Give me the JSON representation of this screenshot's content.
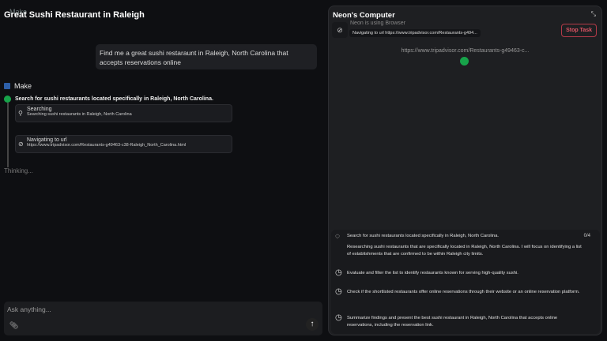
{
  "chat": {
    "title": "Great Sushi Restaurant in Raleigh",
    "ghost": "Make",
    "user_message": "Find me a great sushi restaraunt in Raleigh, North Carolina that accepts reservations online",
    "agent": "Make",
    "step": "Search for sushi restaurants located specifically in Raleigh, North Carolina.",
    "cards": [
      {
        "title": "Searching",
        "sub": "Searching sushi restaurants in Raleigh, North Carolina",
        "icon": "search-icon"
      },
      {
        "title": "Navigating to url",
        "sub": "https://www.tripadvisor.com/Restaurants-g49463-c38-Raleigh_North_Carolina.html",
        "icon": "compass-icon"
      }
    ],
    "thinking": "Thinking...",
    "input_placeholder": "Ask anything..."
  },
  "computer": {
    "title": "Neon's Computer",
    "using": "Neon is using Browser",
    "nav": "Navigating to url https://www.tripadvisor.com/Restaurants-g494...",
    "stop": "Stop Task",
    "url": "https://www.tripadvisor.com/Restaurants-g49463-c...",
    "count": "0/4",
    "tasks": [
      {
        "text": "Search for sushi restaurants located specifically in Raleigh, North Carolina.",
        "detail": "Researching sushi restaurants that are specifically located in Raleigh, North Carolina. I will focus on identifying a list of establishments that are confirmed to be within Raleigh city limits.",
        "status": "in-progress"
      },
      {
        "text": "Evaluate and filter the list to identify restaurants known for serving high-quality sushi.",
        "status": "pending"
      },
      {
        "text": "Check if the shortlisted restaurants offer online reservations through their website or an online reservation platform.",
        "status": "pending"
      },
      {
        "text": "Summarize findings and present the best sushi restaurant in Raleigh, North Carolina that accepts online reservations, including the reservation link.",
        "status": "pending"
      }
    ]
  },
  "colors": {
    "accent_green": "#17a34a",
    "stop_red": "#e05565"
  }
}
